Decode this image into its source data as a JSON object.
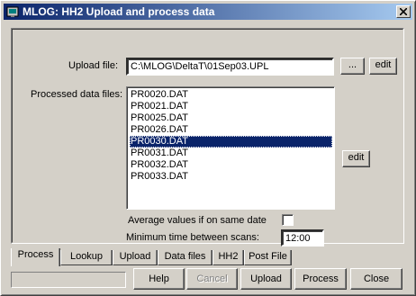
{
  "window": {
    "title": "MLOG: HH2 Upload and process data",
    "close_icon": "close-icon"
  },
  "upload": {
    "label": "Upload file:",
    "value": "C:\\MLOG\\DeltaT\\01Sep03.UPL",
    "browse_label": "...",
    "edit_label": "edit"
  },
  "processed": {
    "label": "Processed data files:",
    "items": [
      "PR0020.DAT",
      "PR0021.DAT",
      "PR0025.DAT",
      "PR0026.DAT",
      "PR0030.DAT",
      "PR0031.DAT",
      "PR0032.DAT",
      "PR0033.DAT"
    ],
    "selected": "PR0030.DAT",
    "edit_label": "edit"
  },
  "options": {
    "average_label": "Average values if on same date",
    "average_checked": false,
    "min_time_label": "Minimum time between scans:",
    "min_time_value": "12:00"
  },
  "tabs": [
    "Process",
    "Lookup",
    "Upload",
    "Data files",
    "HH2",
    "Post File"
  ],
  "active_tab": "Process",
  "buttons": {
    "help": "Help",
    "cancel": "Cancel",
    "upload": "Upload",
    "process": "Process",
    "close": "Close"
  }
}
